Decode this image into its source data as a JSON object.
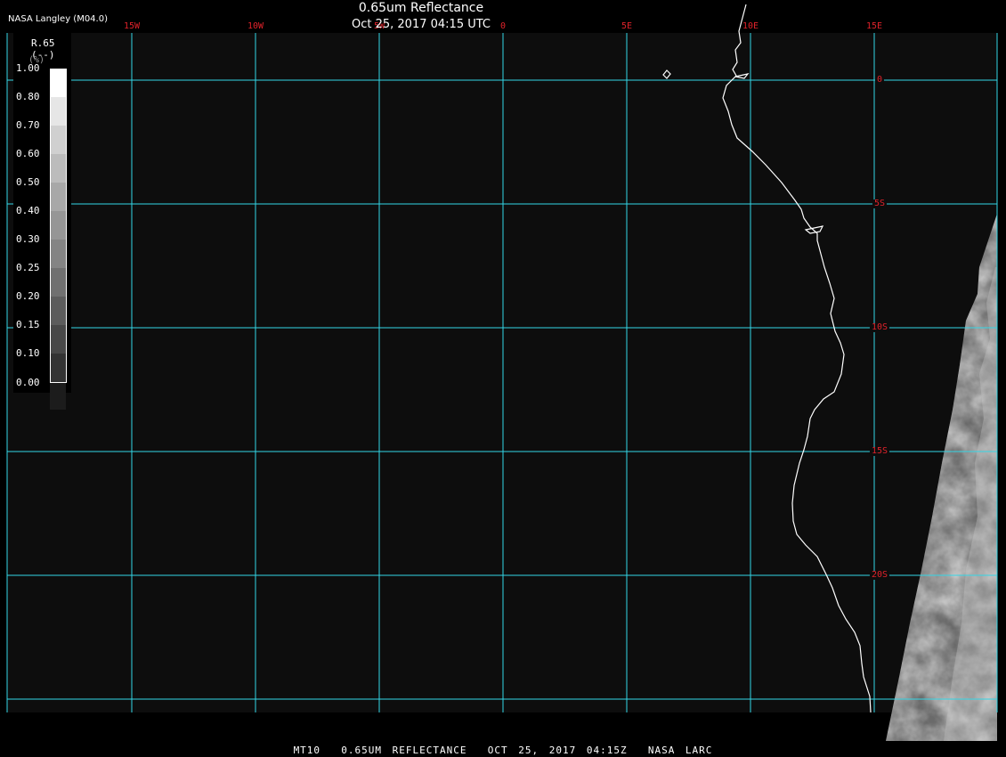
{
  "header": {
    "title": "0.65um Reflectance",
    "subtitle": "Oct 25, 2017 04:15 UTC",
    "producer": "NASA Langley (M04.0)"
  },
  "footer": {
    "text": "MT10  0.65UM REFLECTANCE  OCT 25, 2017 04:15Z  NASA LARC"
  },
  "map": {
    "background_color": "#0d0d0d",
    "grid_color": "#33d6e6",
    "label_color": "#e0222a",
    "coast_color": "#ffffff",
    "longitudes": [
      {
        "label": "15W",
        "deg": -15
      },
      {
        "label": "10W",
        "deg": -10
      },
      {
        "label": "5W",
        "deg": -5
      },
      {
        "label": "0",
        "deg": 0
      },
      {
        "label": "5E",
        "deg": 5
      },
      {
        "label": "10E",
        "deg": 10
      },
      {
        "label": "15E",
        "deg": 15
      }
    ],
    "latitudes": [
      {
        "label": "0",
        "deg": 0
      },
      {
        "label": "5S",
        "deg": -5
      },
      {
        "label": "10S",
        "deg": -10
      },
      {
        "label": "15S",
        "deg": -15
      },
      {
        "label": "20S",
        "deg": -20
      }
    ]
  },
  "colorbar": {
    "variable": "R.65",
    "unit": "(--)",
    "unit_ghost": "(%)",
    "ticks": [
      "1.00",
      "0.80",
      "0.70",
      "0.60",
      "0.50",
      "0.40",
      "0.30",
      "0.25",
      "0.20",
      "0.15",
      "0.10",
      "0.00"
    ],
    "swatch_colors": [
      "#ffffff",
      "#e6e6e6",
      "#d0d0d0",
      "#bcbcbc",
      "#a8a8a8",
      "#969696",
      "#848484",
      "#707070",
      "#5c5c5c",
      "#484848",
      "#333333",
      "#1c1c1c"
    ]
  }
}
